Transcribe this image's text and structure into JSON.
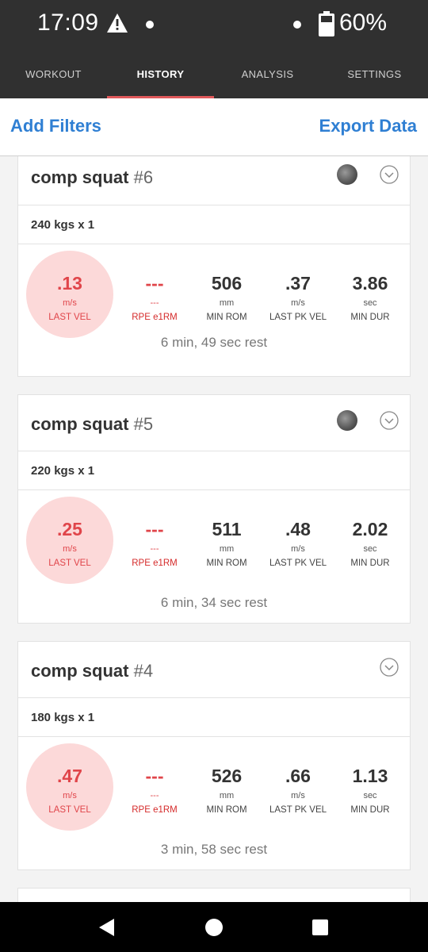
{
  "status_bar": {
    "time": "17:09",
    "battery_pct": "60%",
    "icons": [
      "warning-icon",
      "notification-dot-icon",
      "battery-icon"
    ]
  },
  "tabs": [
    {
      "label": "WORKOUT",
      "active": false
    },
    {
      "label": "HISTORY",
      "active": true
    },
    {
      "label": "ANALYSIS",
      "active": false
    },
    {
      "label": "SETTINGS",
      "active": false
    }
  ],
  "actions": {
    "add_filters": "Add Filters",
    "export_data": "Export Data"
  },
  "colors": {
    "accent_blue": "#2f7fd3",
    "tab_indicator": "#e0585a",
    "velocity_red": "#e0454a",
    "circle_pink": "#fcd9d9"
  },
  "sets": [
    {
      "title": "comp squat",
      "number": "#6",
      "has_thumbnail": true,
      "weight": "240 kgs x 1",
      "last_vel": {
        "value": ".13",
        "unit": "m/s",
        "label": "LAST VEL"
      },
      "rpe": {
        "value": "---",
        "unit": "---",
        "label": "RPE e1RM"
      },
      "min_rom": {
        "value": "506",
        "unit": "mm",
        "label": "MIN ROM"
      },
      "last_pk_vel": {
        "value": ".37",
        "unit": "m/s",
        "label": "LAST PK VEL"
      },
      "min_dur": {
        "value": "3.86",
        "unit": "sec",
        "label": "MIN DUR"
      },
      "rest": "6 min, 49 sec rest"
    },
    {
      "title": "comp squat",
      "number": "#5",
      "has_thumbnail": true,
      "weight": "220 kgs x 1",
      "last_vel": {
        "value": ".25",
        "unit": "m/s",
        "label": "LAST VEL"
      },
      "rpe": {
        "value": "---",
        "unit": "---",
        "label": "RPE e1RM"
      },
      "min_rom": {
        "value": "511",
        "unit": "mm",
        "label": "MIN ROM"
      },
      "last_pk_vel": {
        "value": ".48",
        "unit": "m/s",
        "label": "LAST PK VEL"
      },
      "min_dur": {
        "value": "2.02",
        "unit": "sec",
        "label": "MIN DUR"
      },
      "rest": "6 min, 34 sec rest"
    },
    {
      "title": "comp squat",
      "number": "#4",
      "has_thumbnail": false,
      "weight": "180 kgs x 1",
      "last_vel": {
        "value": ".47",
        "unit": "m/s",
        "label": "LAST VEL"
      },
      "rpe": {
        "value": "---",
        "unit": "---",
        "label": "RPE e1RM"
      },
      "min_rom": {
        "value": "526",
        "unit": "mm",
        "label": "MIN ROM"
      },
      "last_pk_vel": {
        "value": ".66",
        "unit": "m/s",
        "label": "LAST PK VEL"
      },
      "min_dur": {
        "value": "1.13",
        "unit": "sec",
        "label": "MIN DUR"
      },
      "rest": "3 min, 58 sec rest"
    }
  ],
  "nav_bar": {
    "icons": [
      "back-triangle-icon",
      "home-circle-icon",
      "recents-square-icon"
    ]
  }
}
